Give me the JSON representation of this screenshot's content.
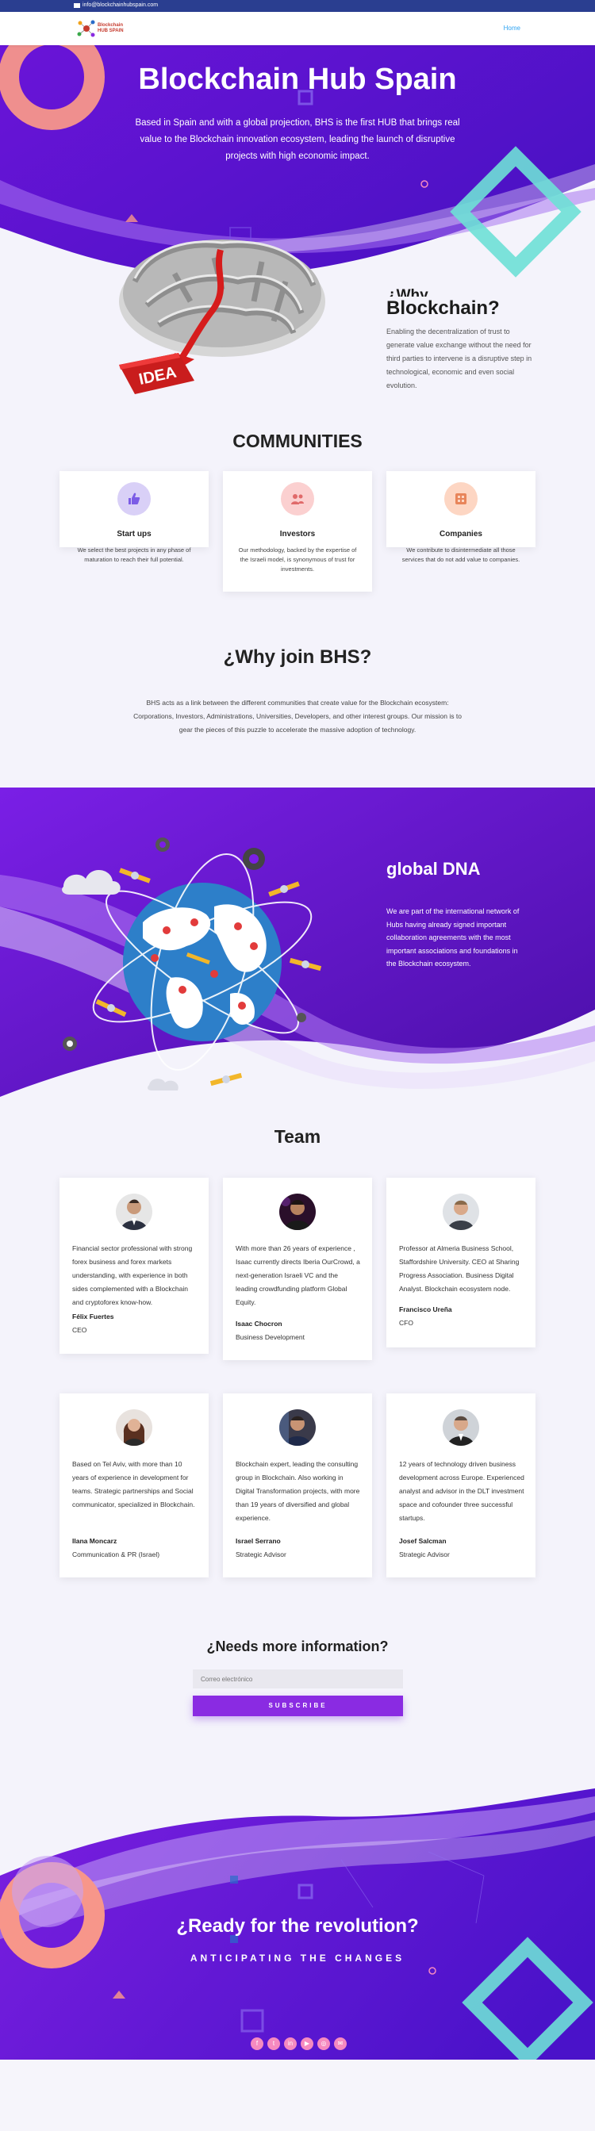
{
  "topbar": {
    "email": "info@blockchainhubspain.com"
  },
  "header": {
    "logo_line1": "Blockchain",
    "logo_line2": "HUB SPAIN",
    "nav_home": "Home"
  },
  "hero": {
    "title": "Blockchain Hub Spain",
    "subtitle": "Based in Spain and with a global projection, BHS is the first HUB that brings real value to the Blockchain innovation ecosystem, leading the launch of disruptive projects with high economic impact."
  },
  "why_blockchain": {
    "prefix": "¿Why",
    "title": "Blockchain?",
    "text": "Enabling the decentralization of trust to generate value exchange without the need for third parties to intervene is a disruptive step in technological, economic and even social evolution.",
    "image_label": "IDEA"
  },
  "communities": {
    "title": "COMMUNITIES",
    "cards": [
      {
        "icon": "thumbs-up-icon",
        "title": "Start ups",
        "text": "We select the best projects in any phase of maturation to reach their full potential."
      },
      {
        "icon": "users-icon",
        "title": "Investors",
        "text": "Our methodology, backed by the expertise of the Israeli model, is synonymous of trust for investments."
      },
      {
        "icon": "building-icon",
        "title": "Companies",
        "text": "We contribute to disintermediate all those services that do not add value to companies."
      }
    ]
  },
  "why_join": {
    "title": "¿Why join BHS?",
    "text": "BHS acts as a link between the different communities that create value for the Blockchain ecosystem: Corporations, Investors, Administrations, Universities, Developers, and other interest groups. Our mission is to gear the pieces of this puzzle to accelerate the massive adoption of technology."
  },
  "global_dna": {
    "title": "global DNA",
    "text": "We are part of the international network of Hubs having already signed important collaboration agreements with the most important associations and foundations in the Blockchain ecosystem."
  },
  "team": {
    "title": "Team",
    "members": [
      {
        "bio": "Financial sector professional with strong forex business and forex markets understanding, with experience in both sides complemented with a Blockchain and cryptoforex know-how.",
        "name": "Félix Fuertes",
        "role": "CEO"
      },
      {
        "bio": "With more than 26 years of experience , Isaac currently directs Iberia OurCrowd, a next-generation Israeli VC and the leading crowdfunding platform Global Equity.",
        "name": "Isaac Chocron",
        "role": "Business Development"
      },
      {
        "bio": "Professor at Almeria Business School, Staffordshire University. CEO at Sharing Progress Association. Business Digital Analyst. Blockchain ecosystem node.",
        "name": "Francisco Ureña",
        "role": "CFO"
      },
      {
        "bio": "Based on Tel Aviv, with more than 10 years of experience in development for teams. Strategic partnerships and Social communicator, specialized in Blockchain.",
        "name": "Ilana Moncarz",
        "role": "Communication & PR (Israel)"
      },
      {
        "bio": "Blockchain expert, leading the consulting group in Blockchain. Also working in Digital Transformation projects, with more than 19 years of diversified and global experience.",
        "name": "Israel Serrano",
        "role": "Strategic Advisor"
      },
      {
        "bio": "12 years of technology driven business development across Europe. Experienced analyst and advisor in the DLT investment space and cofounder three successful startups.",
        "name": "Josef Salcman",
        "role": "Strategic Advisor"
      }
    ]
  },
  "newsletter": {
    "title": "¿Needs more information?",
    "placeholder": "Correo electrónico",
    "button": "SUBSCRIBE"
  },
  "footer": {
    "title": "¿Ready for the revolution?",
    "subtitle": "ANTICIPATING THE CHANGES",
    "socials": [
      {
        "icon": "facebook-icon",
        "glyph": "f"
      },
      {
        "icon": "twitter-icon",
        "glyph": "t"
      },
      {
        "icon": "linkedin-icon",
        "glyph": "in"
      },
      {
        "icon": "youtube-icon",
        "glyph": "▶"
      },
      {
        "icon": "instagram-icon",
        "glyph": "◎"
      },
      {
        "icon": "email-icon",
        "glyph": "✉"
      }
    ]
  },
  "colors": {
    "purple_dark": "#4a12c9",
    "purple": "#7b1fe0",
    "accent_button": "#8a2be2",
    "coral": "#f7968a",
    "teal": "#6ee0d6",
    "pink": "#f68ac0",
    "topbar": "#2a3e90",
    "link": "#2ea3f2"
  }
}
